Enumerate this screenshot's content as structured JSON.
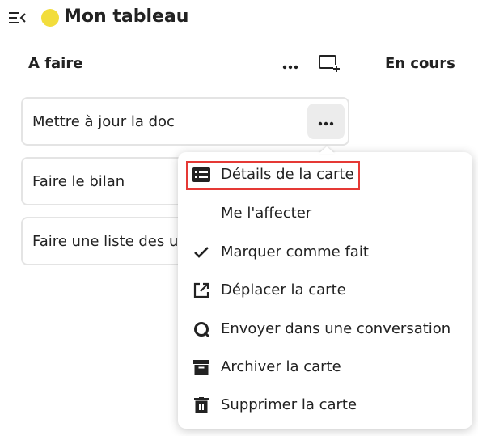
{
  "header": {
    "board_title": "Mon tableau",
    "board_color": "#f2dd3c",
    "menu_icon": "menu-collapse-icon"
  },
  "columns": [
    {
      "title": "A faire"
    },
    {
      "title": "En cours"
    }
  ],
  "column_actions": {
    "more_icon": "more-horizontal-icon",
    "add_card_icon": "add-card-icon"
  },
  "cards": [
    {
      "label": "Mettre à jour la doc"
    },
    {
      "label": "Faire le bilan"
    },
    {
      "label": "Faire une liste des u"
    }
  ],
  "card_menu": {
    "items": [
      {
        "label": "Détails de la carte",
        "icon": "card-details-icon",
        "highlighted": true
      },
      {
        "label": "Me l'affecter",
        "icon": ""
      },
      {
        "label": "Marquer comme fait",
        "icon": "check-icon"
      },
      {
        "label": "Déplacer la carte",
        "icon": "open-in-new-icon"
      },
      {
        "label": "Envoyer dans une conversation",
        "icon": "chat-icon"
      },
      {
        "label": "Archiver la carte",
        "icon": "archive-icon"
      },
      {
        "label": "Supprimer la carte",
        "icon": "trash-icon"
      }
    ],
    "highlight_color": "#e53935"
  }
}
